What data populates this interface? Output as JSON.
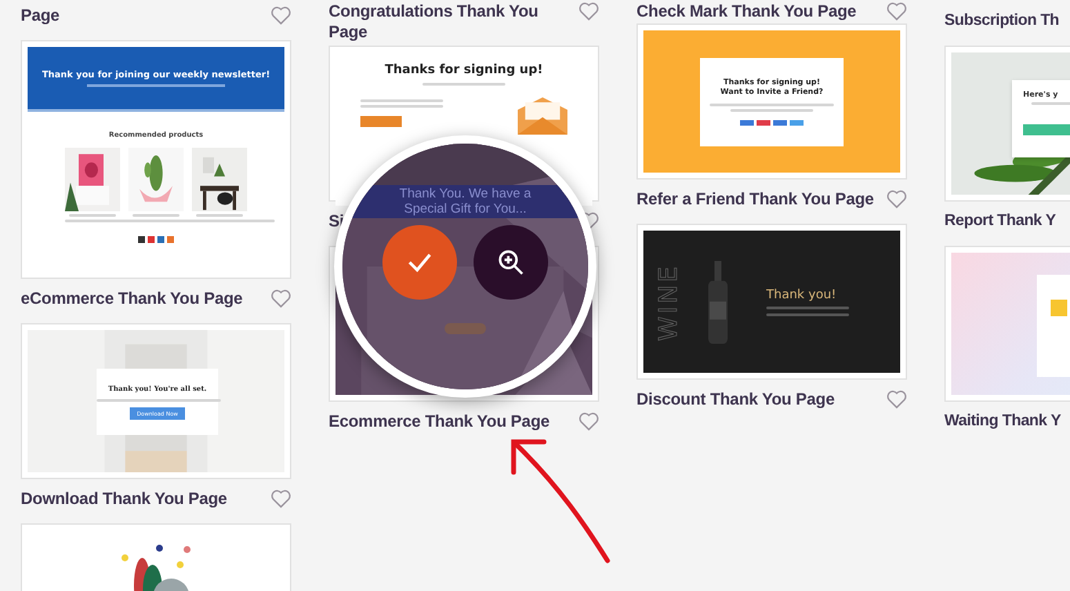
{
  "columns": [
    {
      "items": [
        {
          "kind": "title",
          "text": "Page",
          "heart": true
        },
        {
          "kind": "thumbnail",
          "preview": {
            "kind": "newsletter",
            "headline": "Thank you for joining our weekly newsletter!",
            "section": "Recommended products"
          }
        },
        {
          "kind": "title",
          "text": "eCommerce Thank You Page",
          "heart": true
        },
        {
          "kind": "thumbnail",
          "preview": {
            "kind": "download",
            "headline": "Thank you! You're all set.",
            "button": "Download Now"
          }
        },
        {
          "kind": "title",
          "text": "Download Thank You Page",
          "heart": true
        },
        {
          "kind": "thumbnail",
          "preview": {
            "kind": "festive"
          }
        }
      ]
    },
    {
      "items": [
        {
          "kind": "title",
          "text": "Congratulations Thank You Page",
          "heart": true
        },
        {
          "kind": "thumbnail",
          "preview": {
            "kind": "signup",
            "headline": "Thanks for signing up!"
          }
        },
        {
          "kind": "title",
          "text": "Si",
          "heart": true
        },
        {
          "kind": "thumbnail",
          "preview": {
            "kind": "gift"
          }
        },
        {
          "kind": "title",
          "text": "Ecommerce Thank You Page",
          "heart": true
        }
      ]
    },
    {
      "items": [
        {
          "kind": "title",
          "text": "Check Mark Thank You Page",
          "heart": true
        },
        {
          "kind": "thumbnail",
          "preview": {
            "kind": "refer",
            "headline": "Thanks for signing up! Want to Invite a Friend?"
          }
        },
        {
          "kind": "title",
          "text": "Refer a Friend Thank You Page",
          "heart": true
        },
        {
          "kind": "thumbnail",
          "preview": {
            "kind": "wine",
            "brand": "WINE",
            "headline": "Thank you!"
          }
        },
        {
          "kind": "title",
          "text": "Discount Thank You Page",
          "heart": true
        }
      ]
    },
    {
      "items": [
        {
          "kind": "title",
          "text": "Subscription Th",
          "heart": false
        },
        {
          "kind": "thumbnail",
          "preview": {
            "kind": "subscription",
            "headline": "Here's y"
          }
        },
        {
          "kind": "title",
          "text": "Report Thank Y",
          "heart": false
        },
        {
          "kind": "thumbnail",
          "preview": {
            "kind": "waiting"
          }
        },
        {
          "kind": "title",
          "text": "Waiting Thank Y",
          "heart": false
        }
      ]
    }
  ],
  "magnifier": {
    "banner": "Thank You. We have a Special Gift for You..."
  }
}
